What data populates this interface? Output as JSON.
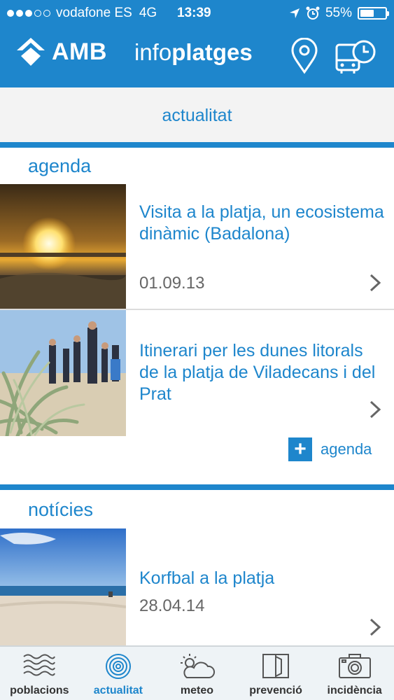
{
  "status": {
    "carrier": "vodafone ES",
    "network": "4G",
    "time": "13:39",
    "battery": "55%",
    "battery_level": 0.55
  },
  "header": {
    "logo": "AMB",
    "title_light": "info",
    "title_bold": "platges"
  },
  "page": {
    "title": "actualitat"
  },
  "agenda": {
    "title": "agenda",
    "items": [
      {
        "title": "Visita a la platja, un ecosistema dinàmic (Badalona)",
        "date": "01.09.13"
      },
      {
        "title": "Itinerari per les dunes litorals de la platja de Viladecans i del Prat",
        "date": ""
      }
    ],
    "add_label": "agenda",
    "add_symbol": "+"
  },
  "news": {
    "title": "notícies",
    "items": [
      {
        "title": "Korfbal a la platja",
        "date": "28.04.14"
      }
    ]
  },
  "tabs": [
    {
      "label": "poblacions",
      "icon": "waves-icon",
      "active": false
    },
    {
      "label": "actualitat",
      "icon": "target-icon",
      "active": true
    },
    {
      "label": "meteo",
      "icon": "sun-cloud-icon",
      "active": false
    },
    {
      "label": "prevenció",
      "icon": "book-icon",
      "active": false
    },
    {
      "label": "incidència",
      "icon": "camera-icon",
      "active": false
    }
  ],
  "colors": {
    "accent": "#1e86cc",
    "date_text": "#666666",
    "tabbar_bg": "#eef3f6"
  }
}
